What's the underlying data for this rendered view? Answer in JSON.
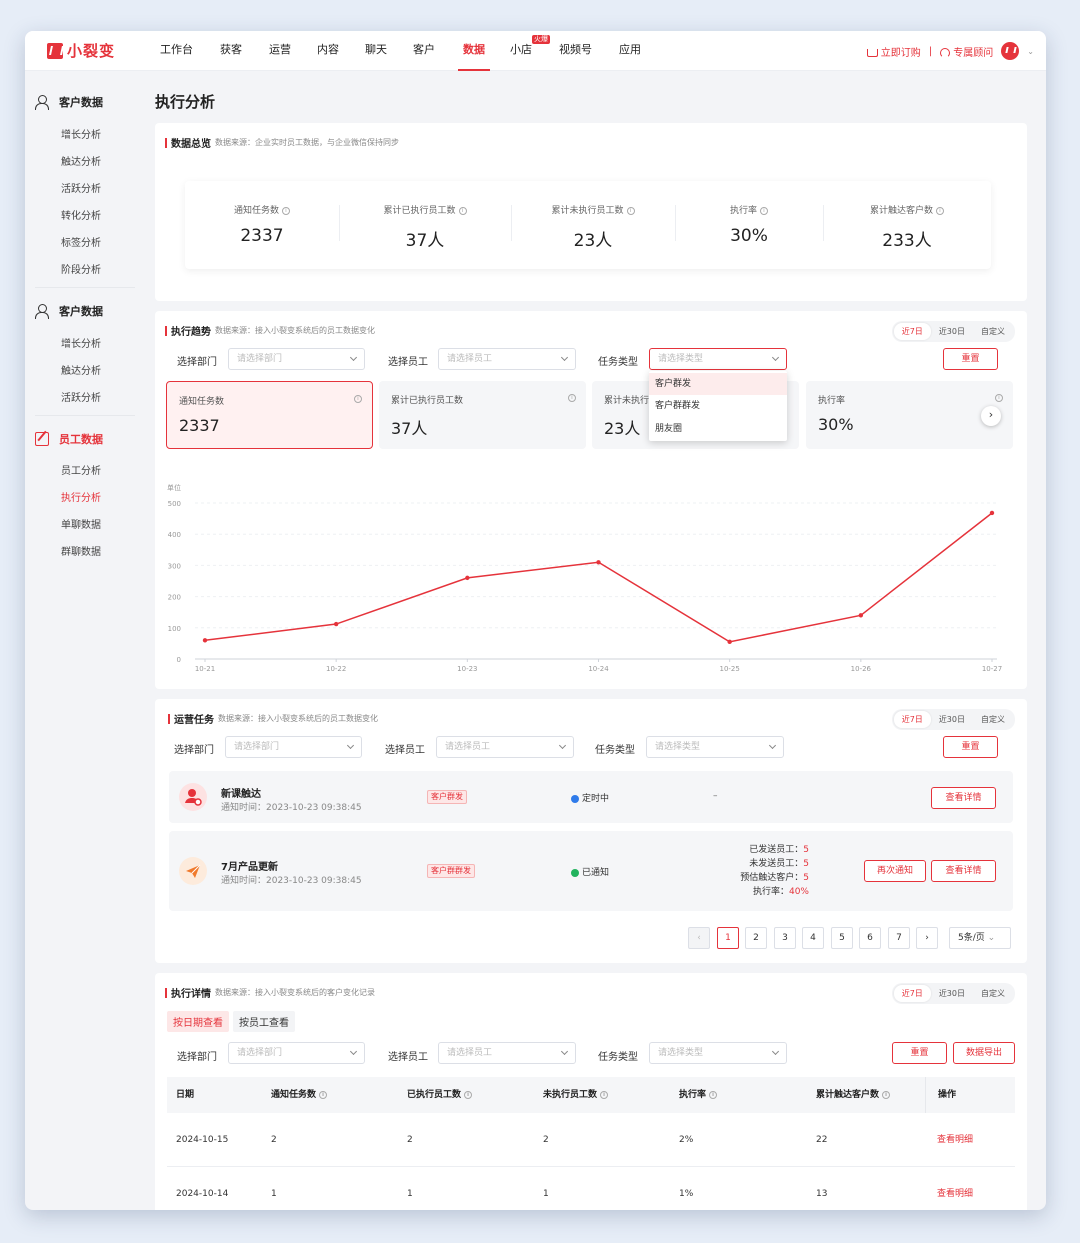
{
  "brand": "小裂变",
  "nav": [
    {
      "label": "工作台"
    },
    {
      "label": "获客"
    },
    {
      "label": "运营"
    },
    {
      "label": "内容"
    },
    {
      "label": "聊天"
    },
    {
      "label": "客户"
    },
    {
      "label": "数据"
    },
    {
      "label": "小店"
    },
    {
      "label": "视频号"
    },
    {
      "label": "应用"
    }
  ],
  "nav_badge": "火爆",
  "topright": {
    "order": "立即订购",
    "sep": "|",
    "advisor": "专属顾问"
  },
  "sidebar": {
    "g1": {
      "title": "客户数据",
      "items": [
        "增长分析",
        "触达分析",
        "活跃分析",
        "转化分析",
        "标签分析",
        "阶段分析"
      ]
    },
    "g2": {
      "title": "客户数据",
      "items": [
        "增长分析",
        "触达分析",
        "活跃分析"
      ]
    },
    "g3": {
      "title": "员工数据",
      "items": [
        "员工分析",
        "执行分析",
        "单聊数据",
        "群聊数据"
      ]
    }
  },
  "page_title": "执行分析",
  "overview": {
    "title": "数据总览",
    "source": "数据来源：企业实时员工数据，与企业微信保持同步",
    "metrics": [
      {
        "label": "通知任务数",
        "value": "2337"
      },
      {
        "label": "累计已执行员工数",
        "value": "37人"
      },
      {
        "label": "累计未执行员工数",
        "value": "23人"
      },
      {
        "label": "执行率",
        "value": "30%"
      },
      {
        "label": "累计触达客户数",
        "value": "233人"
      }
    ]
  },
  "ranges": [
    "近7日",
    "近30日",
    "自定义"
  ],
  "filters": {
    "dept_label": "选择部门",
    "dept_ph": "请选择部门",
    "staff_label": "选择员工",
    "staff_ph": "请选择员工",
    "type_label": "任务类型",
    "type_ph": "请选择类型",
    "reset": "重置",
    "export": "数据导出"
  },
  "trend": {
    "title": "执行趋势",
    "source": "数据来源：接入小裂变系统后的员工数据变化",
    "cards": [
      {
        "label": "通知任务数",
        "value": "2337"
      },
      {
        "label": "累计已执行员工数",
        "value": "37人"
      },
      {
        "label": "累计未执行员工数",
        "value": "23人"
      },
      {
        "label": "执行率",
        "value": "30%"
      }
    ],
    "card3_label_visible": "累计未执行",
    "dropdown": [
      "客户群发",
      "客户群群发",
      "朋友圈"
    ]
  },
  "chart_data": {
    "type": "line",
    "ylabel": "单位",
    "categories": [
      "10-21",
      "10-22",
      "10-23",
      "10-24",
      "10-25",
      "10-26",
      "10-27"
    ],
    "series": [
      {
        "values": [
          60,
          112,
          260,
          310,
          55,
          140,
          468
        ]
      }
    ],
    "ylim": [
      0,
      500
    ],
    "yticks": [
      0,
      100,
      200,
      300,
      400,
      500
    ],
    "grid": true,
    "color": "#e5333b"
  },
  "ops": {
    "title": "运营任务",
    "source": "数据来源：接入小裂变系统后的员工数据变化",
    "tasks": [
      {
        "name": "新课触达",
        "time": "通知时间：2023-10-23 09:38:45",
        "tag": "客户群发",
        "status": "定时中",
        "status_color": "#2f7bea",
        "dash": "–",
        "btn": "查看详情"
      },
      {
        "name": "7月产品更新",
        "time": "通知时间：2023-10-23 09:38:45",
        "tag": "客户群群发",
        "status": "已通知",
        "status_color": "#22b35e",
        "stats": [
          {
            "k": "已发送员工：",
            "v": "5"
          },
          {
            "k": "未发送员工：",
            "v": "5"
          },
          {
            "k": "预估触达客户：",
            "v": "5"
          },
          {
            "k": "执行率：",
            "v": "40%"
          }
        ],
        "btn2": "再次通知",
        "btn": "查看详情"
      }
    ],
    "pages": [
      "1",
      "2",
      "3",
      "4",
      "5",
      "6",
      "7"
    ],
    "page_size": "5条/页"
  },
  "detail": {
    "title": "执行详情",
    "source": "数据来源：接入小裂变系统后的客户变化记录",
    "subtabs": [
      "按日期查看",
      "按员工查看"
    ],
    "columns": [
      "日期",
      "通知任务数",
      "已执行员工数",
      "未执行员工数",
      "执行率",
      "累计触达客户数",
      "操作"
    ],
    "rows": [
      [
        "2024-10-15",
        "2",
        "2",
        "2",
        "2%",
        "22",
        "查看明细"
      ],
      [
        "2024-10-14",
        "1",
        "1",
        "1",
        "1%",
        "13",
        "查看明细"
      ]
    ]
  }
}
